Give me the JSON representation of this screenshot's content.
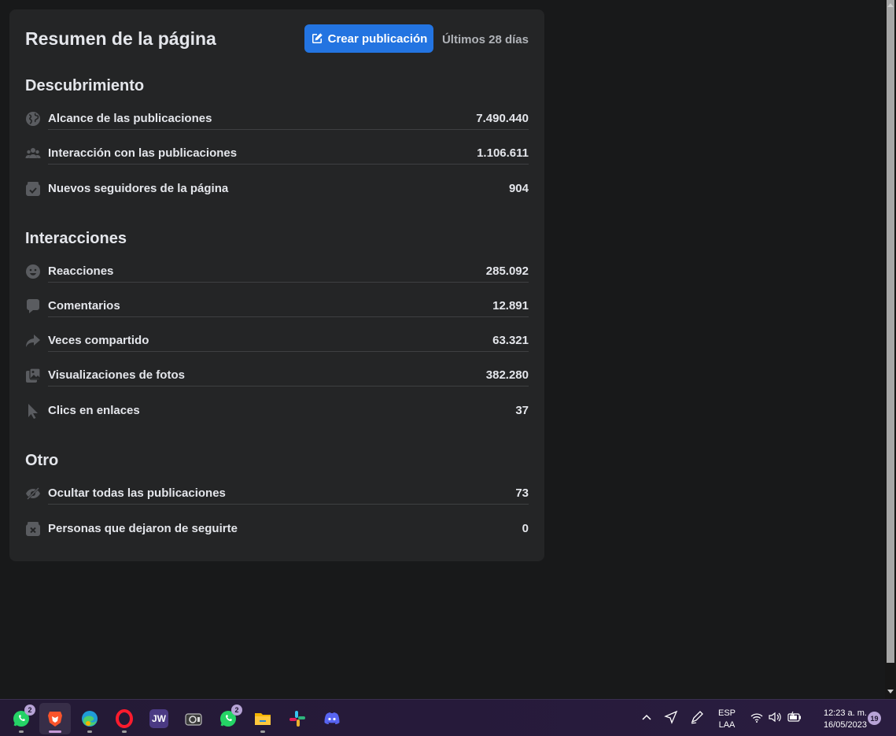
{
  "summary": {
    "title": "Resumen de la página",
    "create_button_label": "Crear publicación",
    "date_range": "Últimos 28 días"
  },
  "sections": {
    "discovery": {
      "title": "Descubrimiento",
      "rows": [
        {
          "label": "Alcance de las publicaciones",
          "value": "7.490.440",
          "icon": "globe-icon"
        },
        {
          "label": "Interacción con las publicaciones",
          "value": "1.106.611",
          "icon": "people-icon"
        },
        {
          "label": "Nuevos seguidores de la página",
          "value": "904",
          "icon": "check-box-icon"
        }
      ]
    },
    "interactions": {
      "title": "Interacciones",
      "rows": [
        {
          "label": "Reacciones",
          "value": "285.092",
          "icon": "smiley-icon"
        },
        {
          "label": "Comentarios",
          "value": "12.891",
          "icon": "comment-icon"
        },
        {
          "label": "Veces compartido",
          "value": "63.321",
          "icon": "share-icon"
        },
        {
          "label": "Visualizaciones de fotos",
          "value": "382.280",
          "icon": "photo-icon"
        },
        {
          "label": "Clics en enlaces",
          "value": "37",
          "icon": "cursor-icon"
        }
      ]
    },
    "other": {
      "title": "Otro",
      "rows": [
        {
          "label": "Ocultar todas las publicaciones",
          "value": "73",
          "icon": "eye-off-icon"
        },
        {
          "label": "Personas que dejaron de seguirte",
          "value": "0",
          "icon": "unfollow-icon"
        }
      ]
    }
  },
  "taskbar": {
    "apps": [
      {
        "name": "whatsapp",
        "badge": "2"
      },
      {
        "name": "brave"
      },
      {
        "name": "edge"
      },
      {
        "name": "opera"
      },
      {
        "name": "jw",
        "label": "JW"
      },
      {
        "name": "camera"
      },
      {
        "name": "whatsapp-2",
        "badge": "2"
      },
      {
        "name": "file-explorer"
      },
      {
        "name": "slack"
      },
      {
        "name": "discord"
      }
    ],
    "language": {
      "line1": "ESP",
      "line2": "LAA"
    },
    "clock": {
      "time": "12:23 a. m.",
      "date": "16/05/2023"
    },
    "notification_count": "19"
  },
  "colors": {
    "background": "#18191a",
    "card": "#242526",
    "accent": "#2374e1",
    "text": "#e4e6eb",
    "muted": "#b0b3b8"
  }
}
